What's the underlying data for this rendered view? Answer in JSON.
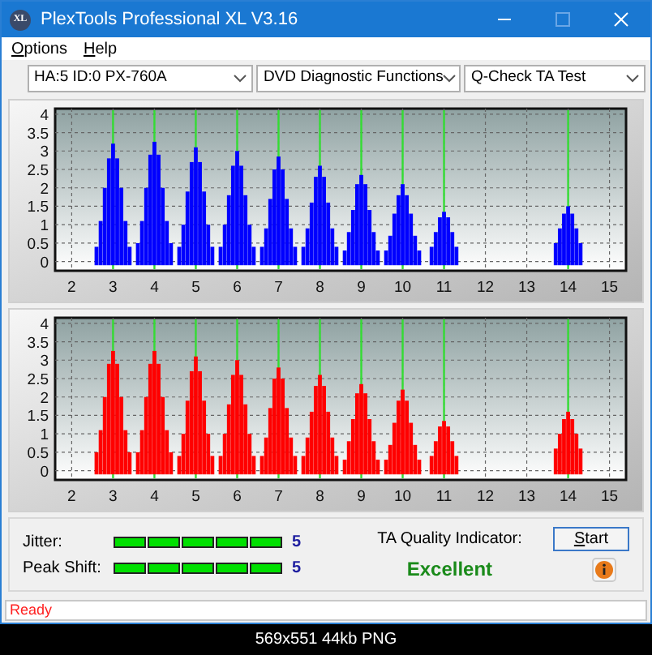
{
  "window": {
    "app_icon": "XL",
    "title": "PlexTools Professional XL V3.16"
  },
  "menu": [
    {
      "label": "Options"
    },
    {
      "label": "Help"
    }
  ],
  "selectors": [
    {
      "value": "HA:5 ID:0  PX-760A"
    },
    {
      "value": "DVD Diagnostic Functions"
    },
    {
      "value": "Q-Check TA Test"
    }
  ],
  "charts": [
    {
      "chart_data": {
        "type": "bar",
        "grid": true,
        "xlim": [
          1.6,
          15.4
        ],
        "ylim": [
          -0.25,
          4.15
        ],
        "xticks": [
          2,
          3,
          4,
          5,
          6,
          7,
          8,
          9,
          10,
          11,
          12,
          13,
          14,
          15
        ],
        "yticks": [
          0,
          0.5,
          1,
          1.5,
          2,
          2.5,
          3,
          3.5,
          4
        ],
        "x": [
          2.6,
          2.7,
          2.8,
          2.9,
          3,
          3.1,
          3.2,
          3.3,
          3.4,
          3.6,
          3.7,
          3.8,
          3.9,
          4,
          4.1,
          4.2,
          4.3,
          4.4,
          4.6,
          4.7,
          4.8,
          4.9,
          5,
          5.1,
          5.2,
          5.3,
          5.4,
          5.6,
          5.7,
          5.8,
          5.9,
          6,
          6.1,
          6.2,
          6.3,
          6.4,
          6.6,
          6.7,
          6.8,
          6.9,
          7,
          7.1,
          7.2,
          7.3,
          7.4,
          7.6,
          7.7,
          7.8,
          7.9,
          8,
          8.1,
          8.2,
          8.3,
          8.4,
          8.6,
          8.7,
          8.8,
          8.9,
          9,
          9.1,
          9.2,
          9.3,
          9.4,
          9.6,
          9.7,
          9.8,
          9.9,
          10,
          10.1,
          10.2,
          10.3,
          10.4,
          10.7,
          10.8,
          10.9,
          11,
          11.1,
          11.2,
          11.3,
          13.7,
          13.8,
          13.9,
          14,
          14.1,
          14.2,
          14.3
        ],
        "series": [
          {
            "color": "#0000ff",
            "values": [
              0.4,
              1.1,
              2.0,
              2.8,
              3.2,
              2.8,
              2.0,
              1.1,
              0.4,
              0.5,
              1.1,
              2.0,
              2.9,
              3.25,
              2.9,
              2.0,
              1.1,
              0.5,
              0.4,
              1.0,
              1.9,
              2.7,
              3.1,
              2.7,
              1.9,
              1.0,
              0.4,
              0.4,
              1.0,
              1.8,
              2.6,
              3.0,
              2.6,
              1.8,
              1.0,
              0.4,
              0.4,
              0.9,
              1.7,
              2.5,
              2.85,
              2.5,
              1.7,
              0.9,
              0.4,
              0.4,
              0.9,
              1.6,
              2.3,
              2.6,
              2.3,
              1.6,
              0.9,
              0.4,
              0.3,
              0.8,
              1.4,
              2.1,
              2.35,
              2.1,
              1.4,
              0.8,
              0.3,
              0.3,
              0.7,
              1.3,
              1.8,
              2.1,
              1.8,
              1.3,
              0.7,
              0.3,
              0.4,
              0.8,
              1.2,
              1.35,
              1.2,
              0.8,
              0.4,
              0.5,
              0.9,
              1.3,
              1.5,
              1.3,
              0.9,
              0.5
            ]
          }
        ]
      }
    },
    {
      "chart_data": {
        "type": "bar",
        "grid": true,
        "xlim": [
          1.6,
          15.4
        ],
        "ylim": [
          -0.25,
          4.15
        ],
        "xticks": [
          2,
          3,
          4,
          5,
          6,
          7,
          8,
          9,
          10,
          11,
          12,
          13,
          14,
          15
        ],
        "yticks": [
          0,
          0.5,
          1,
          1.5,
          2,
          2.5,
          3,
          3.5,
          4
        ],
        "x": [
          2.6,
          2.7,
          2.8,
          2.9,
          3,
          3.1,
          3.2,
          3.3,
          3.4,
          3.6,
          3.7,
          3.8,
          3.9,
          4,
          4.1,
          4.2,
          4.3,
          4.4,
          4.6,
          4.7,
          4.8,
          4.9,
          5,
          5.1,
          5.2,
          5.3,
          5.4,
          5.6,
          5.7,
          5.8,
          5.9,
          6,
          6.1,
          6.2,
          6.3,
          6.4,
          6.6,
          6.7,
          6.8,
          6.9,
          7,
          7.1,
          7.2,
          7.3,
          7.4,
          7.6,
          7.7,
          7.8,
          7.9,
          8,
          8.1,
          8.2,
          8.3,
          8.4,
          8.6,
          8.7,
          8.8,
          8.9,
          9,
          9.1,
          9.2,
          9.3,
          9.4,
          9.6,
          9.7,
          9.8,
          9.9,
          10,
          10.1,
          10.2,
          10.3,
          10.4,
          10.7,
          10.8,
          10.9,
          11,
          11.1,
          11.2,
          11.3,
          13.7,
          13.8,
          13.9,
          14,
          14.1,
          14.2,
          14.3
        ],
        "series": [
          {
            "color": "#ff0000",
            "values": [
              0.5,
              1.1,
              2.0,
              2.9,
              3.25,
              2.9,
              2.0,
              1.1,
              0.5,
              0.5,
              1.1,
              2.0,
              2.9,
              3.25,
              2.9,
              2.0,
              1.1,
              0.5,
              0.4,
              1.0,
              1.9,
              2.7,
              3.1,
              2.7,
              1.9,
              1.0,
              0.4,
              0.4,
              1.0,
              1.8,
              2.6,
              3.0,
              2.6,
              1.8,
              1.0,
              0.4,
              0.4,
              0.9,
              1.7,
              2.5,
              2.8,
              2.5,
              1.7,
              0.9,
              0.4,
              0.4,
              0.9,
              1.6,
              2.3,
              2.6,
              2.3,
              1.6,
              0.9,
              0.4,
              0.3,
              0.8,
              1.4,
              2.1,
              2.35,
              2.1,
              1.4,
              0.8,
              0.3,
              0.3,
              0.7,
              1.3,
              1.9,
              2.2,
              1.9,
              1.3,
              0.7,
              0.3,
              0.4,
              0.8,
              1.2,
              1.35,
              1.2,
              0.8,
              0.4,
              0.6,
              1.0,
              1.4,
              1.6,
              1.4,
              1.0,
              0.6
            ]
          }
        ]
      }
    }
  ],
  "meters": [
    {
      "label": "Jitter:",
      "value": "5"
    },
    {
      "label": "Peak Shift:",
      "value": "5"
    }
  ],
  "quality": {
    "label": "TA Quality Indicator:",
    "value": "Excellent"
  },
  "start_button": {
    "label": "Start"
  },
  "status_bar": {
    "text": "Ready"
  },
  "caption": "569x551 44kb PNG"
}
